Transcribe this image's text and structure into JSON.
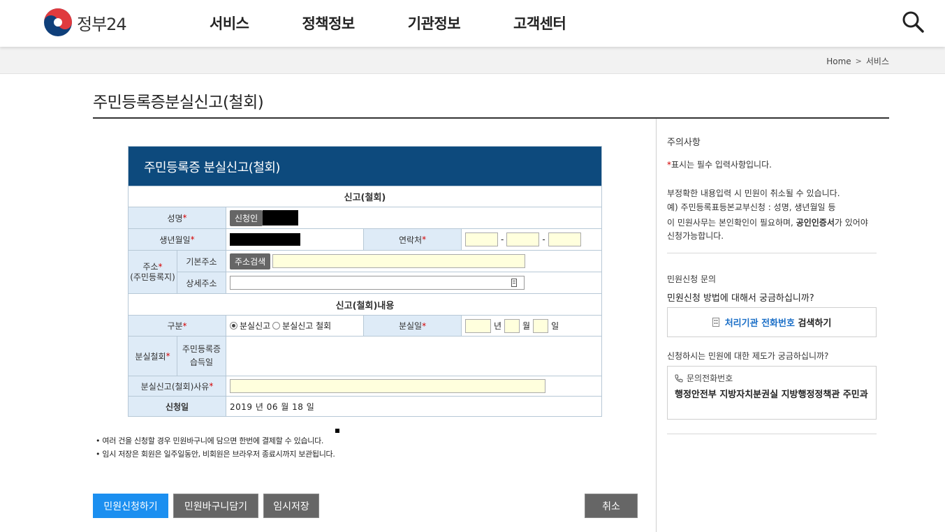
{
  "header": {
    "logo_text": "정부24",
    "nav": [
      "서비스",
      "정책정보",
      "기관정보",
      "고객센터"
    ]
  },
  "breadcrumb": {
    "home": "Home",
    "current": "서비스"
  },
  "page_title": "주민등록증분실신고(철회)",
  "form": {
    "title": "주민등록증 분실신고(철회)",
    "section1": "신고(철회)",
    "name_label": "성명",
    "applicant_chip": "신청인",
    "birth_label": "생년월일",
    "contact_label": "연락처",
    "contact_sep": "-",
    "address_label": "주소",
    "address_sub": "(주민등록지)",
    "basic_address_label": "기본주소",
    "address_search_btn": "주소검색",
    "detail_address_label": "상세주소",
    "section2": "신고(철회)내용",
    "type_label": "구분",
    "type_option1": "분실신고",
    "type_option2": "분실신고 철회",
    "lost_date_label": "분실일",
    "year_unit": "년",
    "month_unit": "월",
    "day_unit": "일",
    "withdraw_label": "분실철회",
    "withdraw_sub": "주민등록증 습득일",
    "reason_label": "분실신고(철회)사유",
    "apply_date_label": "신청일",
    "apply_date_value": "2019 년 06 월 18 일",
    "required_mark": "*"
  },
  "notes": [
    "• 여러 건을 신청할 경우 민원바구니에 담으면 한번에 결제할 수 있습니다.",
    "• 임시 저장은 회원은 일주일동안, 비회원은 브라우저 종료시까지 보관됩니다."
  ],
  "buttons": {
    "apply": "민원신청하기",
    "basket": "민원바구니담기",
    "temp_save": "임시저장",
    "cancel": "취소"
  },
  "side": {
    "notice_title": "주의사항",
    "required_note_mark": "*",
    "required_note": "표시는 필수 입력사항입니다.",
    "inaccurate_note": "부정확한 내용입력 시 민원이 취소될 수 있습니다.",
    "example_note": "예) 주민등록표등본교부신청 : 성명, 생년월일 등",
    "cert_note_pre": "이 민원사무는 본인확인이 필요하며,",
    "cert_note_bold": "공인인증서",
    "cert_note_post": "가 있어야 신청가능합니다.",
    "inquiry_title": "민원신청 문의",
    "inquiry_question": "민원신청 방법에 대해서 궁금하십니까?",
    "agency_btn_blue": "처리기관 전화번호",
    "agency_btn_black": "검색하기",
    "system_question": "신청하시는 민원에 대한 제도가 궁금하십니까?",
    "phone_label": "문의전화번호",
    "phone_org": "행정안전부 지방자치분권실 지방행정정책관 주민과"
  },
  "colors": {
    "brand_navy": "#0d4a7d",
    "label_bg": "#deebf7",
    "input_bg": "#ffffdd",
    "primary_btn": "#1b8ff0",
    "dark_btn": "#666666",
    "required": "#d40000",
    "link_blue": "#1b6fc7"
  }
}
